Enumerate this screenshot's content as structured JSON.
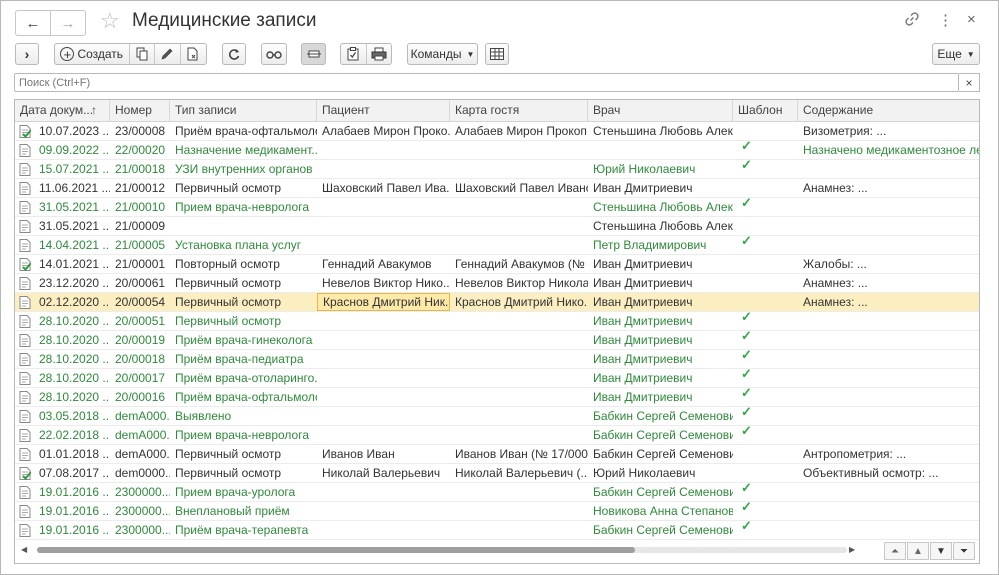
{
  "window": {
    "title": "Медицинские записи",
    "back_icon": "←",
    "forward_icon": "→",
    "star_icon": "☆",
    "link_icon": "🔗",
    "more_icon": "⋮",
    "close_icon": "×"
  },
  "toolbar": {
    "expand_icon": "›",
    "create_label": "Создать",
    "commands_label": "Команды",
    "more_label": "Еще"
  },
  "search": {
    "placeholder": "Поиск (Ctrl+F)",
    "value": "",
    "clear_icon": "×"
  },
  "table": {
    "columns": {
      "date": "Дата докум...",
      "sort_indicator": "↑",
      "number": "Номер",
      "type": "Тип записи",
      "patient": "Пациент",
      "card": "Карта гостя",
      "doctor": "Врач",
      "template": "Шаблон",
      "content": "Содержание"
    },
    "check_mark": "✓",
    "rows": [
      {
        "date": "10.07.2023 ...",
        "number": "23/00008",
        "type": "Приём врача-офтальмоло...",
        "patient": "Алабаев Мирон Проко...",
        "card": "Алабаев Мирон Прокоп...",
        "doctor": "Стеньшина Любовь Алек...",
        "template": "",
        "content": "Визометрия: ..."
      },
      {
        "date": "09.09.2022 ...",
        "number": "22/00020",
        "type": "Назначение медикамент...",
        "patient": "",
        "card": "",
        "doctor": "",
        "template": "✓",
        "content": "Назначено медикаментозное лече..."
      },
      {
        "date": "15.07.2021 ...",
        "number": "21/00018",
        "type": "УЗИ внутренних органов",
        "patient": "",
        "card": "",
        "doctor": "Юрий Николаевич",
        "template": "✓",
        "content": ""
      },
      {
        "date": "11.06.2021 ...",
        "number": "21/00012",
        "type": "Первичный осмотр",
        "patient": "Шаховский Павел Ива...",
        "card": "Шаховский Павел Ивано...",
        "doctor": "Иван Дмитриевич",
        "template": "",
        "content": "Анамнез: ..."
      },
      {
        "date": "31.05.2021 ...",
        "number": "21/00010",
        "type": "Прием врача-невролога",
        "patient": "",
        "card": "",
        "doctor": "Стеньшина Любовь Алек...",
        "template": "✓",
        "content": ""
      },
      {
        "date": "31.05.2021 ...",
        "number": "21/00009",
        "type": "",
        "patient": "",
        "card": "",
        "doctor": "Стеньшина Любовь Алек...",
        "template": "",
        "content": ""
      },
      {
        "date": "14.04.2021 ...",
        "number": "21/00005",
        "type": "Установка плана услуг",
        "patient": "",
        "card": "",
        "doctor": "Петр Владимирович",
        "template": "✓",
        "content": ""
      },
      {
        "date": "14.01.2021 ...",
        "number": "21/00001",
        "type": "Повторный осмотр",
        "patient": "Геннадий Авакумов",
        "card": "Геннадий Авакумов (№ ...",
        "doctor": "Иван Дмитриевич",
        "template": "",
        "content": "Жалобы: ..."
      },
      {
        "date": "23.12.2020 ...",
        "number": "20/00061",
        "type": "Первичный осмотр",
        "patient": "Невелов Виктор Нико...",
        "card": "Невелов Виктор Никола...",
        "doctor": "Иван Дмитриевич",
        "template": "",
        "content": "Анамнез: ..."
      },
      {
        "date": "02.12.2020 ...",
        "number": "20/00054",
        "type": "Первичный осмотр",
        "patient": "Краснов Дмитрий Ник...",
        "card": "Краснов Дмитрий Нико...",
        "doctor": "Иван Дмитриевич",
        "template": "",
        "content": "Анамнез: ..."
      },
      {
        "date": "28.10.2020 ...",
        "number": "20/00051",
        "type": "Первичный осмотр",
        "patient": "",
        "card": "",
        "doctor": "Иван Дмитриевич",
        "template": "✓",
        "content": ""
      },
      {
        "date": "28.10.2020 ...",
        "number": "20/00019",
        "type": "Приём врача-гинеколога",
        "patient": "",
        "card": "",
        "doctor": "Иван Дмитриевич",
        "template": "✓",
        "content": ""
      },
      {
        "date": "28.10.2020 ...",
        "number": "20/00018",
        "type": "Приём врача-педиатра",
        "patient": "",
        "card": "",
        "doctor": "Иван Дмитриевич",
        "template": "✓",
        "content": ""
      },
      {
        "date": "28.10.2020 ...",
        "number": "20/00017",
        "type": "Приём врача-отоларинго...",
        "patient": "",
        "card": "",
        "doctor": "Иван Дмитриевич",
        "template": "✓",
        "content": ""
      },
      {
        "date": "28.10.2020 ...",
        "number": "20/00016",
        "type": "Приём врача-офтальмоло...",
        "patient": "",
        "card": "",
        "doctor": "Иван Дмитриевич",
        "template": "✓",
        "content": ""
      },
      {
        "date": "03.05.2018 ...",
        "number": "demA000...",
        "type": "Выявлено",
        "patient": "",
        "card": "",
        "doctor": "Бабкин Сергей Семенович",
        "template": "✓",
        "content": ""
      },
      {
        "date": "22.02.2018 ...",
        "number": "demA000...",
        "type": "Прием врача-невролога",
        "patient": "",
        "card": "",
        "doctor": "Бабкин Сергей Семенович",
        "template": "✓",
        "content": ""
      },
      {
        "date": "01.01.2018 ...",
        "number": "demA000...",
        "type": "Первичный осмотр",
        "patient": "Иванов Иван",
        "card": "Иванов Иван (№ 17/000...",
        "doctor": "Бабкин Сергей Семенович",
        "template": "",
        "content": "Антропометрия: ..."
      },
      {
        "date": "07.08.2017 ...",
        "number": "dem0000...",
        "type": "Первичный осмотр",
        "patient": "Николай Валерьевич",
        "card": "Николай Валерьевич (...",
        "doctor": "Юрий Николаевич",
        "template": "",
        "content": "Объективный осмотр: ..."
      },
      {
        "date": "19.01.2016 ...",
        "number": "2300000...",
        "type": "Прием врача-уролога",
        "patient": "",
        "card": "",
        "doctor": "Бабкин Сергей Семенович",
        "template": "✓",
        "content": ""
      },
      {
        "date": "19.01.2016 ...",
        "number": "2300000...",
        "type": "Внеплановый приём",
        "patient": "",
        "card": "",
        "doctor": "Новикова Анна Степанов...",
        "template": "✓",
        "content": ""
      },
      {
        "date": "19.01.2016 ...",
        "number": "2300000...",
        "type": "Приём врача-терапевта",
        "patient": "",
        "card": "",
        "doctor": "Бабкин Сергей Семенович",
        "template": "✓",
        "content": ""
      }
    ]
  },
  "row_meta": {
    "template_rows": [
      1,
      2,
      4,
      6,
      10,
      11,
      12,
      13,
      14,
      15,
      16,
      19,
      20,
      21
    ],
    "signed_rows": [
      0,
      7,
      18
    ],
    "selected_row": 9
  },
  "colors": {
    "template_text": "#2f8a3b",
    "selected_row": "#fbeec0",
    "check": "#33a844"
  }
}
